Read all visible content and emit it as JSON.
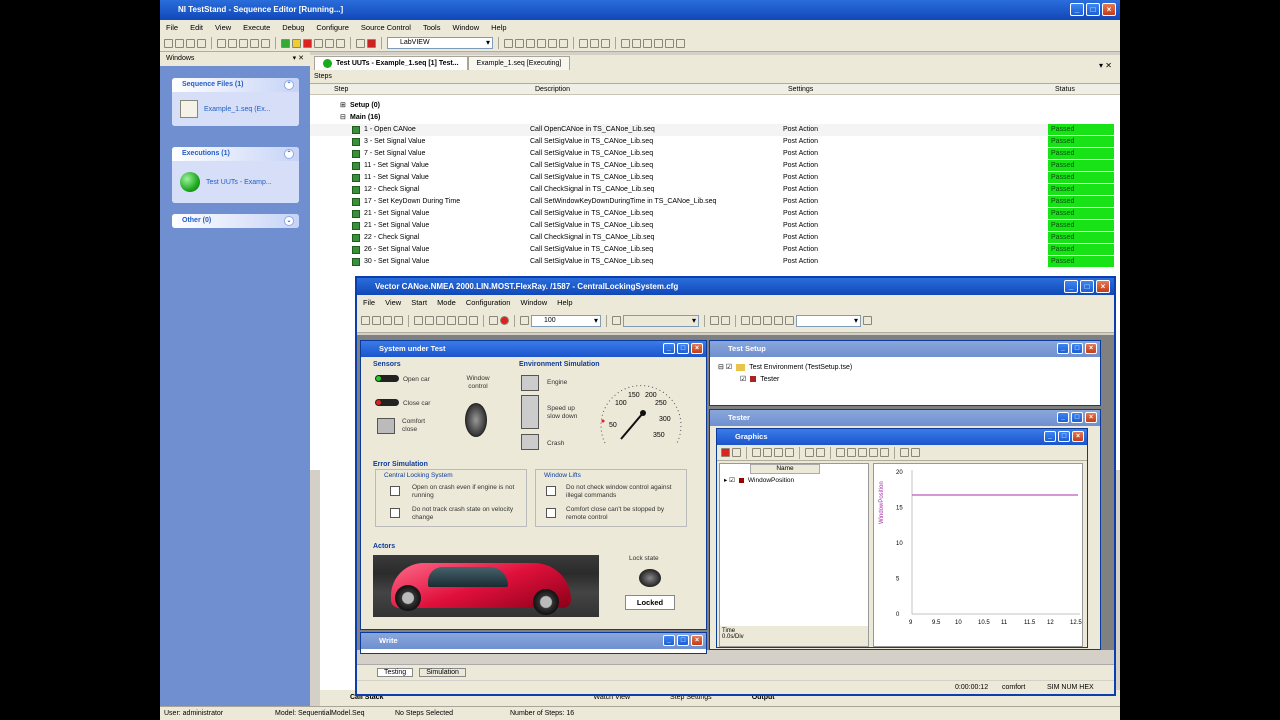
{
  "app": {
    "title": "NI TestStand - Sequence Editor [Running...]",
    "menu": [
      "File",
      "Edit",
      "View",
      "Execute",
      "Debug",
      "Configure",
      "Source Control",
      "Tools",
      "Window",
      "Help"
    ],
    "adapter": "LabVIEW"
  },
  "left_panel": {
    "title": "Windows",
    "groups": [
      {
        "label": "Sequence Files (1)",
        "item": "Example_1.seq (Ex..."
      },
      {
        "label": "Executions (1)",
        "item": "Test UUTs - Examp..."
      },
      {
        "label": "Other (0)",
        "item": ""
      }
    ]
  },
  "doc_tabs": [
    {
      "label": "Test UUTs - Example_1.seq [1] Test...",
      "active": true
    },
    {
      "label": "Example_1.seq [Executing]",
      "active": false
    }
  ],
  "steps": {
    "header": "Steps",
    "columns": [
      "Step",
      "Description",
      "Settings",
      "Status"
    ],
    "groups": [
      "Setup (0)",
      "Main (16)"
    ],
    "rows": [
      {
        "step": "1 - Open CANoe",
        "desc": "Call OpenCANoe in TS_CANoe_Lib.seq",
        "settings": "Post Action",
        "status": "Passed"
      },
      {
        "step": "3 - Set Signal Value",
        "desc": "Call SetSigValue in TS_CANoe_Lib.seq",
        "settings": "Post Action",
        "status": "Passed"
      },
      {
        "step": "7 - Set Signal Value",
        "desc": "Call SetSigValue in TS_CANoe_Lib.seq",
        "settings": "Post Action",
        "status": "Passed"
      },
      {
        "step": "11 - Set Signal Value",
        "desc": "Call SetSigValue in TS_CANoe_Lib.seq",
        "settings": "Post Action",
        "status": "Passed"
      },
      {
        "step": "11 - Set Signal Value",
        "desc": "Call SetSigValue in TS_CANoe_Lib.seq",
        "settings": "Post Action",
        "status": "Passed"
      },
      {
        "step": "12 - Check Signal",
        "desc": "Call CheckSignal in TS_CANoe_Lib.seq",
        "settings": "Post Action",
        "status": "Passed"
      },
      {
        "step": "17 - Set KeyDown During Time",
        "desc": "Call SetWindowKeyDownDuringTime in TS_CANoe_Lib.seq",
        "settings": "Post Action",
        "status": "Passed"
      },
      {
        "step": "21 - Set Signal Value",
        "desc": "Call SetSigValue in TS_CANoe_Lib.seq",
        "settings": "Post Action",
        "status": "Passed"
      },
      {
        "step": "21 - Set Signal Value",
        "desc": "Call SetSigValue in TS_CANoe_Lib.seq",
        "settings": "Post Action",
        "status": "Passed"
      },
      {
        "step": "22 - Check Signal",
        "desc": "Call CheckSignal in TS_CANoe_Lib.seq",
        "settings": "Post Action",
        "status": "Passed"
      },
      {
        "step": "26 - Set Signal Value",
        "desc": "Call SetSigValue in TS_CANoe_Lib.seq",
        "settings": "Post Action",
        "status": "Passed"
      },
      {
        "step": "30 - Set Signal Value",
        "desc": "Call SetSigValue in TS_CANoe_Lib.seq",
        "settings": "Post Action",
        "status": "Passed"
      }
    ]
  },
  "canoe": {
    "title": "Vector CANoe.NMEA 2000.LIN.MOST.FlexRay. /1587  - CentralLockingSystem.cfg",
    "menu": [
      "File",
      "View",
      "Start",
      "Mode",
      "Configuration",
      "Window",
      "Help"
    ],
    "zoom": "100",
    "sut": {
      "title": "System under Test",
      "sensors_label": "Sensors",
      "open_car": "Open car",
      "close_car": "Close car",
      "comfort_close": "Comfort close",
      "window_control": "Window control",
      "env_label": "Environment Simulation",
      "engine": "Engine",
      "speed": "Speed up slow down",
      "crash": "Crash",
      "gauge_ticks": [
        "50",
        "100",
        "150",
        "200",
        "250",
        "300",
        "350"
      ],
      "error_label": "Error Simulation",
      "cls_label": "Central Locking System",
      "opt1": "Open on crash even if engine is not running",
      "opt2": "Do not track crash state on velocity change",
      "wl_label": "Window Lifts",
      "opt3": "Do not check window control against illegal commands",
      "opt4": "Comfort close can't be stopped by remote control",
      "actors_label": "Actors",
      "lock_state_label": "Lock state",
      "lock_state": "Locked"
    },
    "test_setup": {
      "title": "Test Setup",
      "env": "Test Environment (TestSetup.tse)",
      "tester": "Tester"
    },
    "tester_title": "Tester",
    "graphics": {
      "title": "Graphics",
      "name_col": "Name",
      "signal": "WindowPosition",
      "y_axis_label": "WindowPosition",
      "y_ticks": [
        "20",
        "15",
        "10",
        "5",
        "0"
      ],
      "x_ticks": [
        "9",
        "9.5",
        "10",
        "10.5",
        "11",
        "11.5",
        "12",
        "12.5"
      ],
      "time_label": "Time",
      "time_val": "0.0s/Div"
    },
    "write_title": "Write",
    "bottom_tabs": [
      "Testing",
      "Simulation"
    ],
    "status": {
      "time": "0:00:00:12",
      "mode": "comfort",
      "caps": "SIM NUM HEX"
    }
  },
  "bottom_panes": [
    "Call Stack",
    "Watch View",
    "Step Settings",
    "Output"
  ],
  "statusbar": {
    "user": "User: administrator",
    "model": "Model: SequentialModel.Seq",
    "selected": "No Steps Selected",
    "count": "Number of Steps: 16"
  }
}
